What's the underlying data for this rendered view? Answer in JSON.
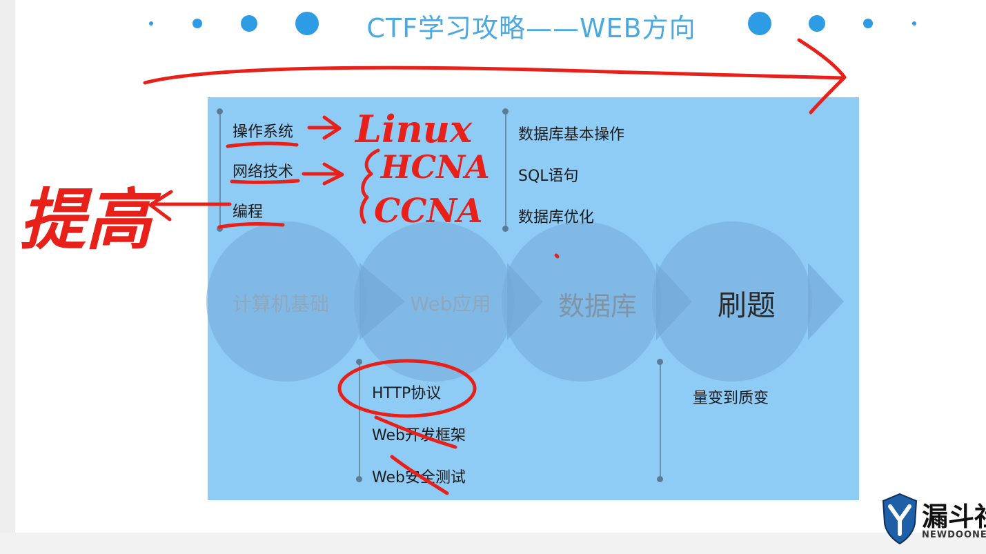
{
  "slide": {
    "title": "CTF学习攻略——WEB方向",
    "accent_color": "#2e9ce4",
    "panel_color": "#8ecbf5",
    "topics_top_left": [
      "操作系统",
      "网络技术",
      "编程"
    ],
    "topics_top_right": [
      "数据库基本操作",
      "SQL语句",
      "数据库优化"
    ],
    "steps": [
      "计算机基础",
      "Web应用",
      "数据库",
      "刷题"
    ],
    "topics_bottom_left": [
      "HTTP协议",
      "Web开发框架",
      "Web安全测试"
    ],
    "topics_bottom_right": [
      "量变到质变"
    ]
  },
  "annotations": {
    "color": "#e8201a",
    "ink_text": [
      "Linux",
      "HCNA",
      "CCNA",
      "提高"
    ]
  },
  "logo": {
    "name": "漏斗社",
    "sub": "NEWDOONE",
    "icon": "shield-y-icon"
  }
}
